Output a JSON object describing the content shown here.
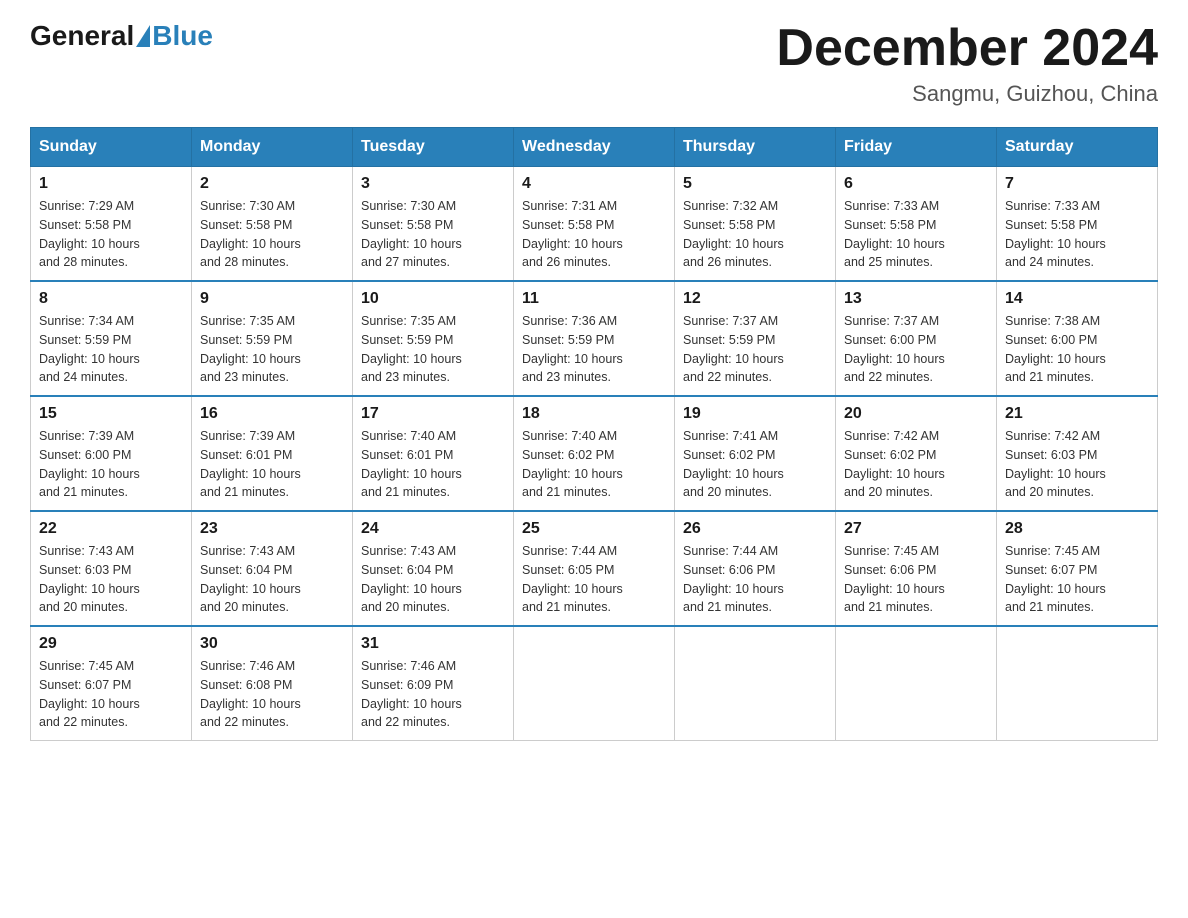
{
  "logo": {
    "general": "General",
    "blue": "Blue"
  },
  "title": "December 2024",
  "location": "Sangmu, Guizhou, China",
  "days_of_week": [
    "Sunday",
    "Monday",
    "Tuesday",
    "Wednesday",
    "Thursday",
    "Friday",
    "Saturday"
  ],
  "weeks": [
    [
      {
        "day": "1",
        "sunrise": "7:29 AM",
        "sunset": "5:58 PM",
        "daylight": "10 hours and 28 minutes."
      },
      {
        "day": "2",
        "sunrise": "7:30 AM",
        "sunset": "5:58 PM",
        "daylight": "10 hours and 28 minutes."
      },
      {
        "day": "3",
        "sunrise": "7:30 AM",
        "sunset": "5:58 PM",
        "daylight": "10 hours and 27 minutes."
      },
      {
        "day": "4",
        "sunrise": "7:31 AM",
        "sunset": "5:58 PM",
        "daylight": "10 hours and 26 minutes."
      },
      {
        "day": "5",
        "sunrise": "7:32 AM",
        "sunset": "5:58 PM",
        "daylight": "10 hours and 26 minutes."
      },
      {
        "day": "6",
        "sunrise": "7:33 AM",
        "sunset": "5:58 PM",
        "daylight": "10 hours and 25 minutes."
      },
      {
        "day": "7",
        "sunrise": "7:33 AM",
        "sunset": "5:58 PM",
        "daylight": "10 hours and 24 minutes."
      }
    ],
    [
      {
        "day": "8",
        "sunrise": "7:34 AM",
        "sunset": "5:59 PM",
        "daylight": "10 hours and 24 minutes."
      },
      {
        "day": "9",
        "sunrise": "7:35 AM",
        "sunset": "5:59 PM",
        "daylight": "10 hours and 23 minutes."
      },
      {
        "day": "10",
        "sunrise": "7:35 AM",
        "sunset": "5:59 PM",
        "daylight": "10 hours and 23 minutes."
      },
      {
        "day": "11",
        "sunrise": "7:36 AM",
        "sunset": "5:59 PM",
        "daylight": "10 hours and 23 minutes."
      },
      {
        "day": "12",
        "sunrise": "7:37 AM",
        "sunset": "5:59 PM",
        "daylight": "10 hours and 22 minutes."
      },
      {
        "day": "13",
        "sunrise": "7:37 AM",
        "sunset": "6:00 PM",
        "daylight": "10 hours and 22 minutes."
      },
      {
        "day": "14",
        "sunrise": "7:38 AM",
        "sunset": "6:00 PM",
        "daylight": "10 hours and 21 minutes."
      }
    ],
    [
      {
        "day": "15",
        "sunrise": "7:39 AM",
        "sunset": "6:00 PM",
        "daylight": "10 hours and 21 minutes."
      },
      {
        "day": "16",
        "sunrise": "7:39 AM",
        "sunset": "6:01 PM",
        "daylight": "10 hours and 21 minutes."
      },
      {
        "day": "17",
        "sunrise": "7:40 AM",
        "sunset": "6:01 PM",
        "daylight": "10 hours and 21 minutes."
      },
      {
        "day": "18",
        "sunrise": "7:40 AM",
        "sunset": "6:02 PM",
        "daylight": "10 hours and 21 minutes."
      },
      {
        "day": "19",
        "sunrise": "7:41 AM",
        "sunset": "6:02 PM",
        "daylight": "10 hours and 20 minutes."
      },
      {
        "day": "20",
        "sunrise": "7:42 AM",
        "sunset": "6:02 PM",
        "daylight": "10 hours and 20 minutes."
      },
      {
        "day": "21",
        "sunrise": "7:42 AM",
        "sunset": "6:03 PM",
        "daylight": "10 hours and 20 minutes."
      }
    ],
    [
      {
        "day": "22",
        "sunrise": "7:43 AM",
        "sunset": "6:03 PM",
        "daylight": "10 hours and 20 minutes."
      },
      {
        "day": "23",
        "sunrise": "7:43 AM",
        "sunset": "6:04 PM",
        "daylight": "10 hours and 20 minutes."
      },
      {
        "day": "24",
        "sunrise": "7:43 AM",
        "sunset": "6:04 PM",
        "daylight": "10 hours and 20 minutes."
      },
      {
        "day": "25",
        "sunrise": "7:44 AM",
        "sunset": "6:05 PM",
        "daylight": "10 hours and 21 minutes."
      },
      {
        "day": "26",
        "sunrise": "7:44 AM",
        "sunset": "6:06 PM",
        "daylight": "10 hours and 21 minutes."
      },
      {
        "day": "27",
        "sunrise": "7:45 AM",
        "sunset": "6:06 PM",
        "daylight": "10 hours and 21 minutes."
      },
      {
        "day": "28",
        "sunrise": "7:45 AM",
        "sunset": "6:07 PM",
        "daylight": "10 hours and 21 minutes."
      }
    ],
    [
      {
        "day": "29",
        "sunrise": "7:45 AM",
        "sunset": "6:07 PM",
        "daylight": "10 hours and 22 minutes."
      },
      {
        "day": "30",
        "sunrise": "7:46 AM",
        "sunset": "6:08 PM",
        "daylight": "10 hours and 22 minutes."
      },
      {
        "day": "31",
        "sunrise": "7:46 AM",
        "sunset": "6:09 PM",
        "daylight": "10 hours and 22 minutes."
      },
      null,
      null,
      null,
      null
    ]
  ],
  "labels": {
    "sunrise": "Sunrise:",
    "sunset": "Sunset:",
    "daylight": "Daylight:"
  }
}
